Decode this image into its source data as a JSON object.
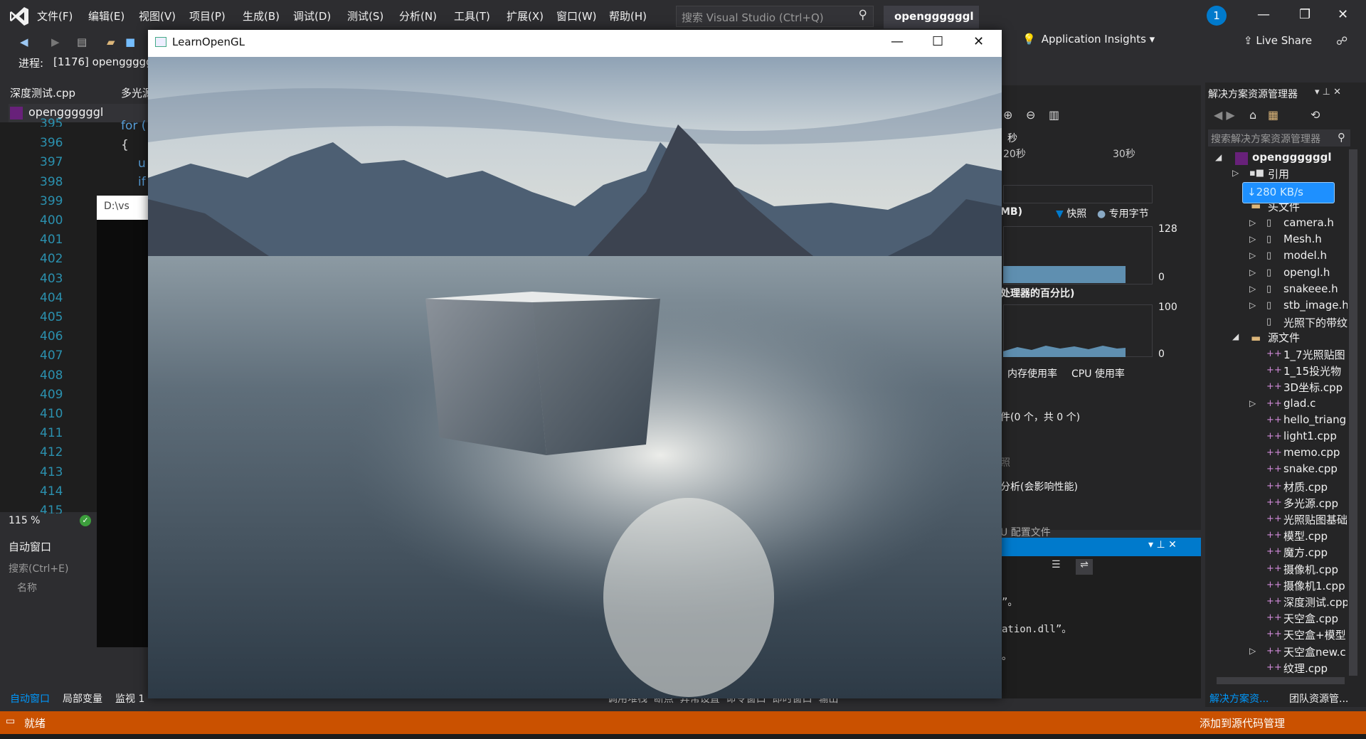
{
  "menu": {
    "items": [
      "文件(F)",
      "编辑(E)",
      "视图(V)",
      "项目(P)",
      "生成(B)",
      "调试(D)",
      "测试(S)",
      "分析(N)",
      "工具(T)",
      "扩展(X)",
      "窗口(W)",
      "帮助(H)"
    ],
    "search_placeholder": "搜索 Visual Studio (Ctrl+Q)",
    "project_name": "openggggggl",
    "notification_count": "1"
  },
  "toolbar": {
    "app_insights": "Application Insights",
    "live_share": "Live Share",
    "process_label": "进程:",
    "process_value": "[1176] openggggg"
  },
  "editor": {
    "tabs": [
      "深度测试.cpp",
      "多光源"
    ],
    "nav_project": "openggggggl",
    "line_numbers": [
      "395",
      "396",
      "397",
      "398",
      "399",
      "400",
      "401",
      "402",
      "403",
      "404",
      "405",
      "406",
      "407",
      "408",
      "409",
      "410",
      "411",
      "412",
      "413",
      "414",
      "415"
    ],
    "code_fragments": [
      "for (",
      "{",
      "u",
      "if"
    ],
    "console_title": "D:\\vs",
    "zoom": "115 %"
  },
  "autos": {
    "title": "自动窗口",
    "search_placeholder": "搜索(Ctrl+E)",
    "column_name": "名称",
    "bottom_tabs": [
      "自动窗口",
      "局部变量",
      "监视 1"
    ]
  },
  "diagnostics": {
    "unit_seconds": "秒",
    "time_20": "20秒",
    "time_30": "30秒",
    "memory_label": "MB)",
    "legend_snapshot": "快照",
    "legend_private": "专用字节",
    "memory_max": "128",
    "memory_min": "0",
    "cpu_label": "处理器的百分比)",
    "cpu_max": "100",
    "cpu_min": "0",
    "tab_memory": "内存使用率",
    "tab_cpu": "CPU 使用率",
    "events": "件(0 个，共 0 个)",
    "events_sub": "照",
    "profile": "分析(会影响性能)",
    "profile_more": "U 配置文件"
  },
  "output": {
    "line1": "”。",
    "line2": "ation.dll”。",
    "line3": "。"
  },
  "gl_window": {
    "title": "LearnOpenGL"
  },
  "solution_explorer": {
    "title": "解决方案资源管理器",
    "search_placeholder": "搜索解决方案资源管理器",
    "root": "openggggggl",
    "references": "引用",
    "speed_badge": "↓280 KB/s",
    "header_folder": "头文件",
    "headers": [
      "camera.h",
      "Mesh.h",
      "model.h",
      "opengl.h",
      "snakeee.h",
      "stb_image.h",
      "光照下的带纹"
    ],
    "source_folder": "源文件",
    "sources": [
      "1_7光照贴图",
      "1_15投光物",
      "3D坐标.cpp",
      "glad.c",
      "hello_triang",
      "light1.cpp",
      "memo.cpp",
      "snake.cpp",
      "材质.cpp",
      "多光源.cpp",
      "光照贴图基础",
      "模型.cpp",
      "魔方.cpp",
      "摄像机.cpp",
      "摄像机1.cpp",
      "深度测试.cpp",
      "天空盒.cpp",
      "天空盒+模型",
      "天空盒new.c",
      "纹理.cpp"
    ],
    "bottom_tabs": [
      "解决方案资...",
      "团队资源管..."
    ]
  },
  "bottom_center_tabs": "调用堆栈  断点  异常设置  命令窗口  即时窗口  输出",
  "status": {
    "text": "就绪",
    "right": "添加到源代码管理"
  },
  "colors": {
    "accent": "#007acc",
    "status_bar": "#ca5100",
    "background": "#2d2d30"
  }
}
